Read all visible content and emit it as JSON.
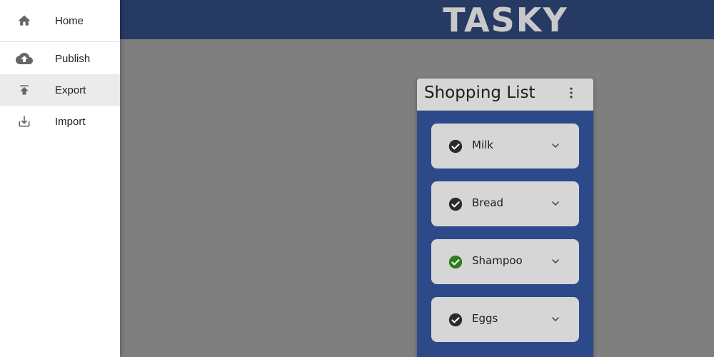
{
  "app": {
    "logo_text": "TASKY",
    "colors": {
      "appbar": "#263a64",
      "card_bg": "#2c4a8a",
      "overlay": "#7f7f7f",
      "checked_dark": "#2b2b2b",
      "checked_green": "#2e7d1e"
    }
  },
  "drawer": {
    "items": [
      {
        "label": "Home",
        "icon": "home-icon",
        "selected": false
      },
      {
        "label": "Publish",
        "icon": "cloud-upload-icon",
        "selected": false
      },
      {
        "label": "Export",
        "icon": "export-icon",
        "selected": true
      },
      {
        "label": "Import",
        "icon": "download-icon",
        "selected": false
      }
    ]
  },
  "list": {
    "title": "Shopping List",
    "menu_icon": "more-vert-icon",
    "items": [
      {
        "name": "Milk",
        "check_color": "#2b2b2b",
        "expand_icon": "chevron-down-icon"
      },
      {
        "name": "Bread",
        "check_color": "#2b2b2b",
        "expand_icon": "chevron-down-icon"
      },
      {
        "name": "Shampoo",
        "check_color": "#2e7d1e",
        "expand_icon": "chevron-down-icon"
      },
      {
        "name": "Eggs",
        "check_color": "#2b2b2b",
        "expand_icon": "chevron-down-icon"
      }
    ]
  }
}
